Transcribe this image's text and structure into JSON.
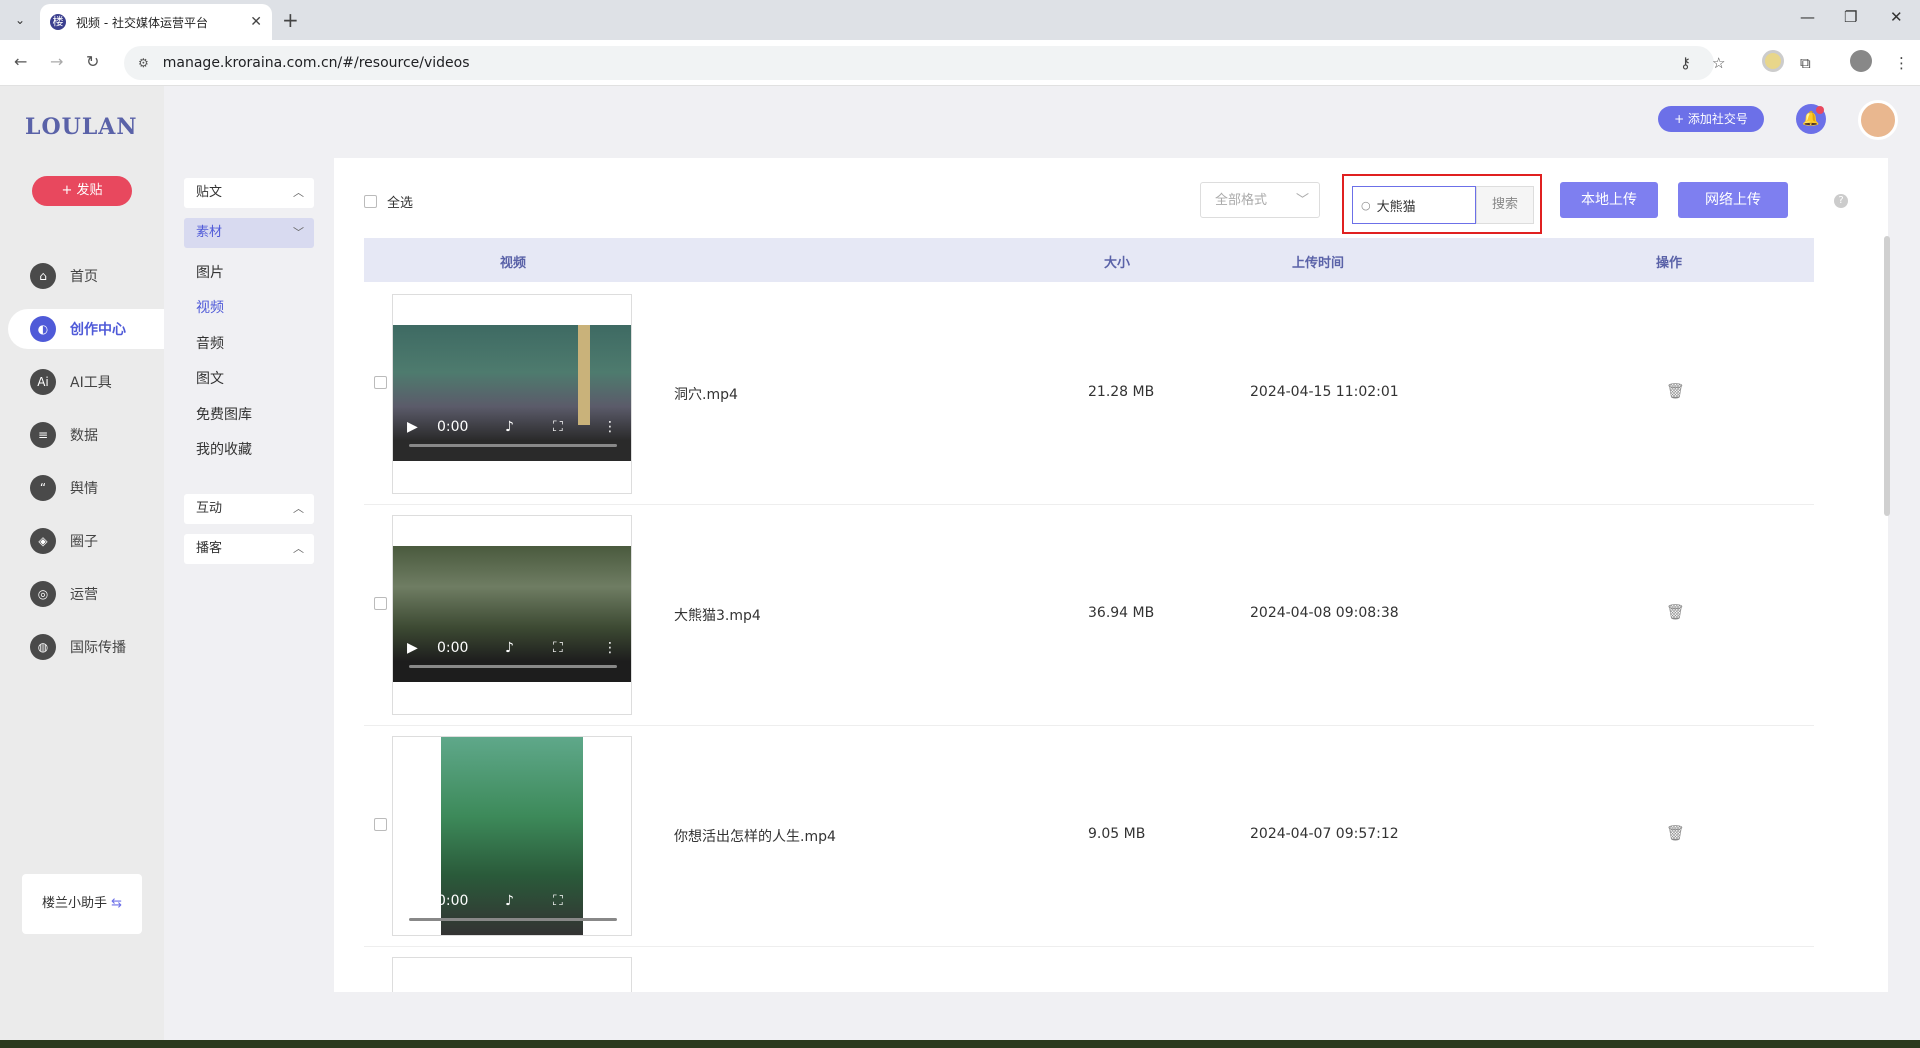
{
  "browser": {
    "tab_title": "视频 - 社交媒体运营平台",
    "url": "manage.kroraina.com.cn/#/resource/videos"
  },
  "app": {
    "logo": "LOULAN",
    "post_button": "+ 发贴",
    "nav": [
      {
        "label": "首页",
        "icon": "home-icon"
      },
      {
        "label": "创作中心",
        "icon": "palette-icon",
        "active": true
      },
      {
        "label": "AI工具",
        "icon": "ai-icon"
      },
      {
        "label": "数据",
        "icon": "database-icon"
      },
      {
        "label": "舆情",
        "icon": "quote-icon"
      },
      {
        "label": "圈子",
        "icon": "compass-icon"
      },
      {
        "label": "运营",
        "icon": "operations-icon"
      },
      {
        "label": "国际传播",
        "icon": "globe-icon"
      }
    ],
    "helper": "楼兰小助手",
    "add_social": "+ 添加社交号"
  },
  "subnav": {
    "groups": [
      {
        "label": "贴文"
      },
      {
        "label": "素材",
        "active": true
      },
      {
        "label": "互动"
      },
      {
        "label": "播客"
      }
    ],
    "items": [
      {
        "label": "图片"
      },
      {
        "label": "视频",
        "active": true
      },
      {
        "label": "音频"
      },
      {
        "label": "图文"
      },
      {
        "label": "免费图库"
      },
      {
        "label": "我的收藏"
      }
    ]
  },
  "toolbar": {
    "select_all": "全选",
    "format_placeholder": "全部格式",
    "search_value": "大熊猫",
    "search_button": "搜索",
    "local_upload": "本地上传",
    "web_upload": "网络上传"
  },
  "table": {
    "headers": {
      "video": "视频",
      "size": "大小",
      "uploaded": "上传时间",
      "actions": "操作"
    },
    "rows": [
      {
        "name": "洞穴.mp4",
        "size": "21.28 MB",
        "time": "2024-04-15 11:02:01",
        "video_time": "0:00"
      },
      {
        "name": "大熊猫3.mp4",
        "size": "36.94 MB",
        "time": "2024-04-08 09:08:38",
        "video_time": "0:00"
      },
      {
        "name": "你想活出怎样的人生.mp4",
        "size": "9.05 MB",
        "time": "2024-04-07 09:57:12",
        "video_time": "0:00"
      }
    ]
  },
  "colors": {
    "accent": "#6c70e8",
    "danger": "#e8485e",
    "highlight": "#e02020"
  }
}
